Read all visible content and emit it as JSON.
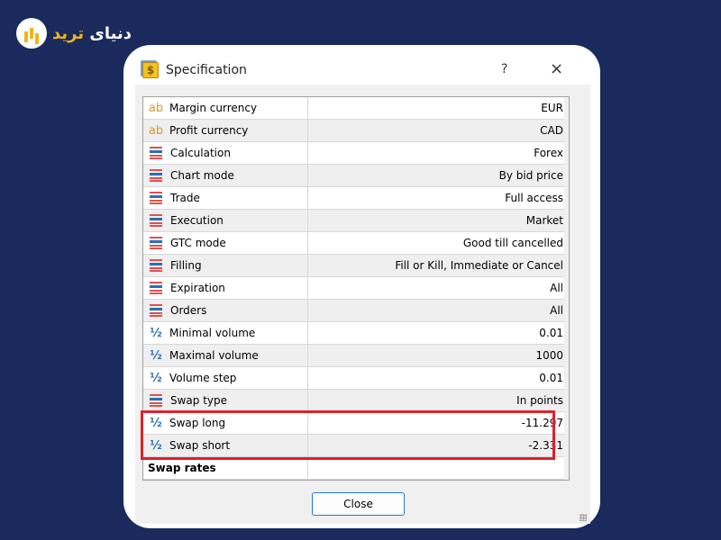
{
  "logo": {
    "text_white": "دنیای",
    "text_yellow": "ترید"
  },
  "dialog": {
    "title": "Specification",
    "help": "?",
    "close_icon": "×",
    "close_label": "Close"
  },
  "rows": [
    {
      "icon": "ab",
      "label": "Margin currency",
      "value": "EUR"
    },
    {
      "icon": "ab",
      "label": "Profit currency",
      "value": "CAD"
    },
    {
      "icon": "lines",
      "label": "Calculation",
      "value": "Forex"
    },
    {
      "icon": "lines",
      "label": "Chart mode",
      "value": "By bid price"
    },
    {
      "icon": "lines",
      "label": "Trade",
      "value": "Full access"
    },
    {
      "icon": "lines",
      "label": "Execution",
      "value": "Market"
    },
    {
      "icon": "lines",
      "label": "GTC mode",
      "value": "Good till cancelled"
    },
    {
      "icon": "lines",
      "label": "Filling",
      "value": "Fill or Kill, Immediate or Cancel"
    },
    {
      "icon": "lines",
      "label": "Expiration",
      "value": "All"
    },
    {
      "icon": "lines",
      "label": "Orders",
      "value": "All"
    },
    {
      "icon": "half",
      "label": "Minimal volume",
      "value": "0.01"
    },
    {
      "icon": "half",
      "label": "Maximal volume",
      "value": "1000"
    },
    {
      "icon": "half",
      "label": "Volume step",
      "value": "0.01"
    },
    {
      "icon": "lines",
      "label": "Swap type",
      "value": "In points"
    },
    {
      "icon": "half",
      "label": "Swap long",
      "value": "-11.297"
    },
    {
      "icon": "half",
      "label": "Swap short",
      "value": "-2.331"
    }
  ],
  "section": "Swap rates",
  "highlight_color": "#e0202a"
}
